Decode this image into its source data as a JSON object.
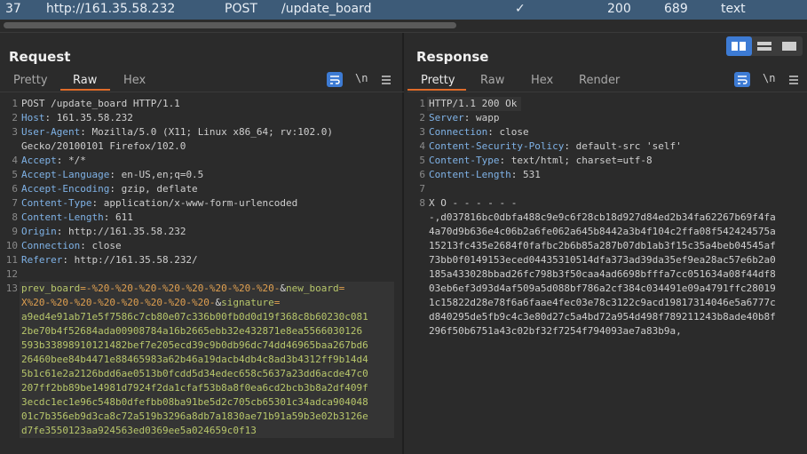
{
  "history_row": {
    "number": "37",
    "host": "http://161.35.58.232",
    "method": "POST",
    "url": "/update_board",
    "edited": "✓",
    "status": "200",
    "length": "689",
    "mime": "text"
  },
  "request": {
    "title": "Request",
    "tabs": [
      "Pretty",
      "Raw",
      "Hex"
    ],
    "active_tab": "Raw",
    "newline_toggle": "\\n",
    "lines": [
      {
        "n": "1",
        "text": "POST /update_board HTTP/1.1"
      },
      {
        "n": "2",
        "key": "Host",
        "val": " 161.35.58.232"
      },
      {
        "n": "3",
        "key": "User-Agent",
        "val": " Mozilla/5.0 (X11; Linux x86_64; rv:102.0)"
      },
      {
        "n": "",
        "text": "Gecko/20100101 Firefox/102.0"
      },
      {
        "n": "4",
        "key": "Accept",
        "val": " */*"
      },
      {
        "n": "5",
        "key": "Accept-Language",
        "val": " en-US,en;q=0.5"
      },
      {
        "n": "6",
        "key": "Accept-Encoding",
        "val": " gzip, deflate"
      },
      {
        "n": "7",
        "key": "Content-Type",
        "val": " application/x-www-form-urlencoded"
      },
      {
        "n": "8",
        "key": "Content-Length",
        "val": " 611"
      },
      {
        "n": "9",
        "key": "Origin",
        "val": " http://161.35.58.232"
      },
      {
        "n": "10",
        "key": "Connection",
        "val": " close"
      },
      {
        "n": "11",
        "key": "Referer",
        "val": " http://161.35.58.232/"
      },
      {
        "n": "12",
        "text": ""
      }
    ],
    "body_line_number": "13",
    "body": {
      "prev_board_key": "prev_board",
      "prev_board_val": "-%20-%20-%20-%20-%20-%20-%20-%20-",
      "new_board_key": "new_board",
      "new_board_val_l1": "X%20-%20-%20-%20-%20-%20-%20-%20-",
      "signature_key": "signature",
      "signature_lines": [
        "a9ed4e91ab71e5f7586c7cb80e07c336b00fb0d0d19f368c8b60230c081",
        "2be70b4f52684ada00908784a16b2665ebb32e432871e8ea5566030126",
        "593b33898910121482bef7e205ecd39c9b0db96dc74dd46965baa267bd6",
        "26460bee84b4471e88465983a62b46a19dacb4db4c8ad3b4312ff9b14d4",
        "5b1c61e2a2126bdd6ae0513b0fcdd5d34edec658c5637a23dd6acde47c0",
        "207ff2bb89be14981d7924f2da1cfaf53b8a8f0ea6cd2bcb3b8a2df409f",
        "3ecdc1ec1e96c548b0dfefbb08ba91be5d2c705cb65301c34adca904048",
        "01c7b356eb9d3ca8c72a519b3296a8db7a1830ae71b91a59b3e02b3126e",
        "d7fe3550123aa924563ed0369ee5a024659c0f13"
      ]
    }
  },
  "response": {
    "title": "Response",
    "tabs": [
      "Pretty",
      "Raw",
      "Hex",
      "Render"
    ],
    "active_tab": "Pretty",
    "newline_toggle": "\\n",
    "lines": [
      {
        "n": "1",
        "text": "HTTP/1.1 200 Ok"
      },
      {
        "n": "2",
        "key": "Server",
        "val": " wapp"
      },
      {
        "n": "3",
        "key": "Connection",
        "val": " close"
      },
      {
        "n": "4",
        "key": "Content-Security-Policy",
        "val": " default-src 'self'"
      },
      {
        "n": "5",
        "key": "Content-Type",
        "val": " text/html; charset=utf-8"
      },
      {
        "n": "6",
        "key": "Content-Length",
        "val": " 531"
      },
      {
        "n": "7",
        "text": ""
      }
    ],
    "body_line_number": "8",
    "body_lines": [
      "X O - - - - - -",
      "-,d037816bc0dbfa488c9e9c6f28cb18d927d84ed2b34fa62267b69f4fa",
      "4a70d9b636e4c06b2a6fe062a645b8442a3b4f104c2ffa08f542424575a",
      "15213fc435e2684f0fafbc2b6b85a287b07db1ab3f15c35a4beb04545af",
      "73bb0f0149153eced04435310514dfa373ad39da35ef9ea28ac57e6b2a0",
      "185a433028bbad26fc798b3f50caa4ad6698bfffa7cc051634a08f44df8",
      "03eb6ef3d93d4af509a5d088bf786a2cf384c034491e09a4791ffc28019",
      "1c15822d28e78f6a6faae4fec03e78c3122c9acd19817314046e5a6777c",
      "d840295de5fb9c4c3e80d27c5a4bd72a954d498f789211243b8ade40b8f",
      "296f50b6751a43c02bf32f7254f794093ae7a83b9a,"
    ]
  },
  "colors": {
    "selected_row": "#3d5b78",
    "accent": "#e06c2a",
    "header_key": "#7fb2e6",
    "body_value": "#b8c76b",
    "active_button": "#3d7bd4"
  }
}
